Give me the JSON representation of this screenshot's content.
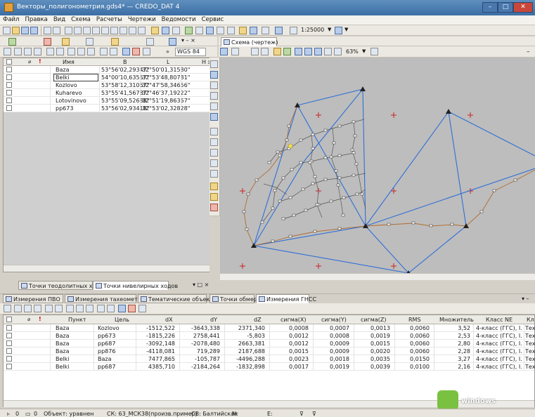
{
  "window": {
    "title": "Векторы_полигонометрия.gds4* — CREDO_DAT 4",
    "min": "–",
    "max": "□",
    "close": "✕"
  },
  "menu": [
    "Файл",
    "Правка",
    "Вид",
    "Схема",
    "Расчеты",
    "Чертежи",
    "Ведомости",
    "Сервис"
  ],
  "toolbar": {
    "scale": "1:25000",
    "coord_system": "WGS 84",
    "zoom": "63%"
  },
  "points_table": {
    "headers": [
      "Имя",
      "B",
      "L",
      "Н эл."
    ],
    "rows": [
      {
        "name": "Baza",
        "b": "53°56'02,29347\"",
        "l": "32°50'01,31580\""
      },
      {
        "name": "Belki",
        "b": "54°00'10,63557\"",
        "l": "32°53'48,80781\""
      },
      {
        "name": "Kozlovo",
        "b": "53°58'12,31067\"",
        "l": "32°47'58,34656\""
      },
      {
        "name": "Kuharevo",
        "b": "53°55'41,56787\"",
        "l": "32°46'37,19222\""
      },
      {
        "name": "Lotovinovo",
        "b": "53°55'09,52688\"",
        "l": "32°51'19,86367\""
      },
      {
        "name": "pp673",
        "b": "53°56'02,93418\"",
        "l": "32°53'02,32828\""
      }
    ]
  },
  "left_tabs": [
    "Точки теодолитных ходов",
    "Точки нивелирных ходов"
  ],
  "scheme_tab": "Схема (чертеж)",
  "bottom_tabs": [
    "Измерения ПВО",
    "Измерения тахеометрии",
    "Тематические объекты",
    "Точки обмера",
    "Измерения ГНСС"
  ],
  "gnss_table": {
    "headers": [
      "Пункт",
      "Цель",
      "dX",
      "dY",
      "dZ",
      "сигма(X)",
      "сигма(Y)",
      "сигма(Z)",
      "RMS",
      "Множитель",
      "Класс NE",
      "Кл"
    ],
    "rows": [
      [
        "Baza",
        "Kozlovo",
        "-1512,522",
        "-3643,338",
        "2371,340",
        "0,0008",
        "0,0007",
        "0,0013",
        "0,0060",
        "3,52",
        "4-класс (ГГС), I...",
        "Тех"
      ],
      [
        "Baza",
        "pp673",
        "-1815,226",
        "2758,441",
        "-5,803",
        "0,0012",
        "0,0008",
        "0,0019",
        "0,0060",
        "2,53",
        "4-класс (ГГС), I...",
        "Тех"
      ],
      [
        "Baza",
        "pp687",
        "-3092,148",
        "-2078,480",
        "2663,381",
        "0,0012",
        "0,0009",
        "0,0015",
        "0,0060",
        "2,80",
        "4-класс (ГГС), I...",
        "Тех"
      ],
      [
        "Baza",
        "pp876",
        "-4118,081",
        "719,289",
        "2187,688",
        "0,0015",
        "0,0009",
        "0,0020",
        "0,0060",
        "2,28",
        "4-класс (ГГС), I...",
        "Тех"
      ],
      [
        "Belki",
        "Baza",
        "7477,865",
        "-105,787",
        "-4496,288",
        "0,0023",
        "0,0018",
        "0,0035",
        "0,0150",
        "3,27",
        "4-класс (ГГС), I...",
        "Тех"
      ],
      [
        "Belki",
        "pp687",
        "4385,710",
        "-2184,264",
        "-1832,898",
        "0,0017",
        "0,0019",
        "0,0039",
        "0,0100",
        "2,16",
        "4-класс (ГГС), I...",
        "Тех"
      ]
    ]
  },
  "status": {
    "count1": "0",
    "count2": "0",
    "object": "Объект: уравнен",
    "sk": "СК: 63_МСК38(произв.пример)",
    "sr": "СВ: Балтийская",
    "n": "N:",
    "e": "E:"
  },
  "watermark": "windows"
}
